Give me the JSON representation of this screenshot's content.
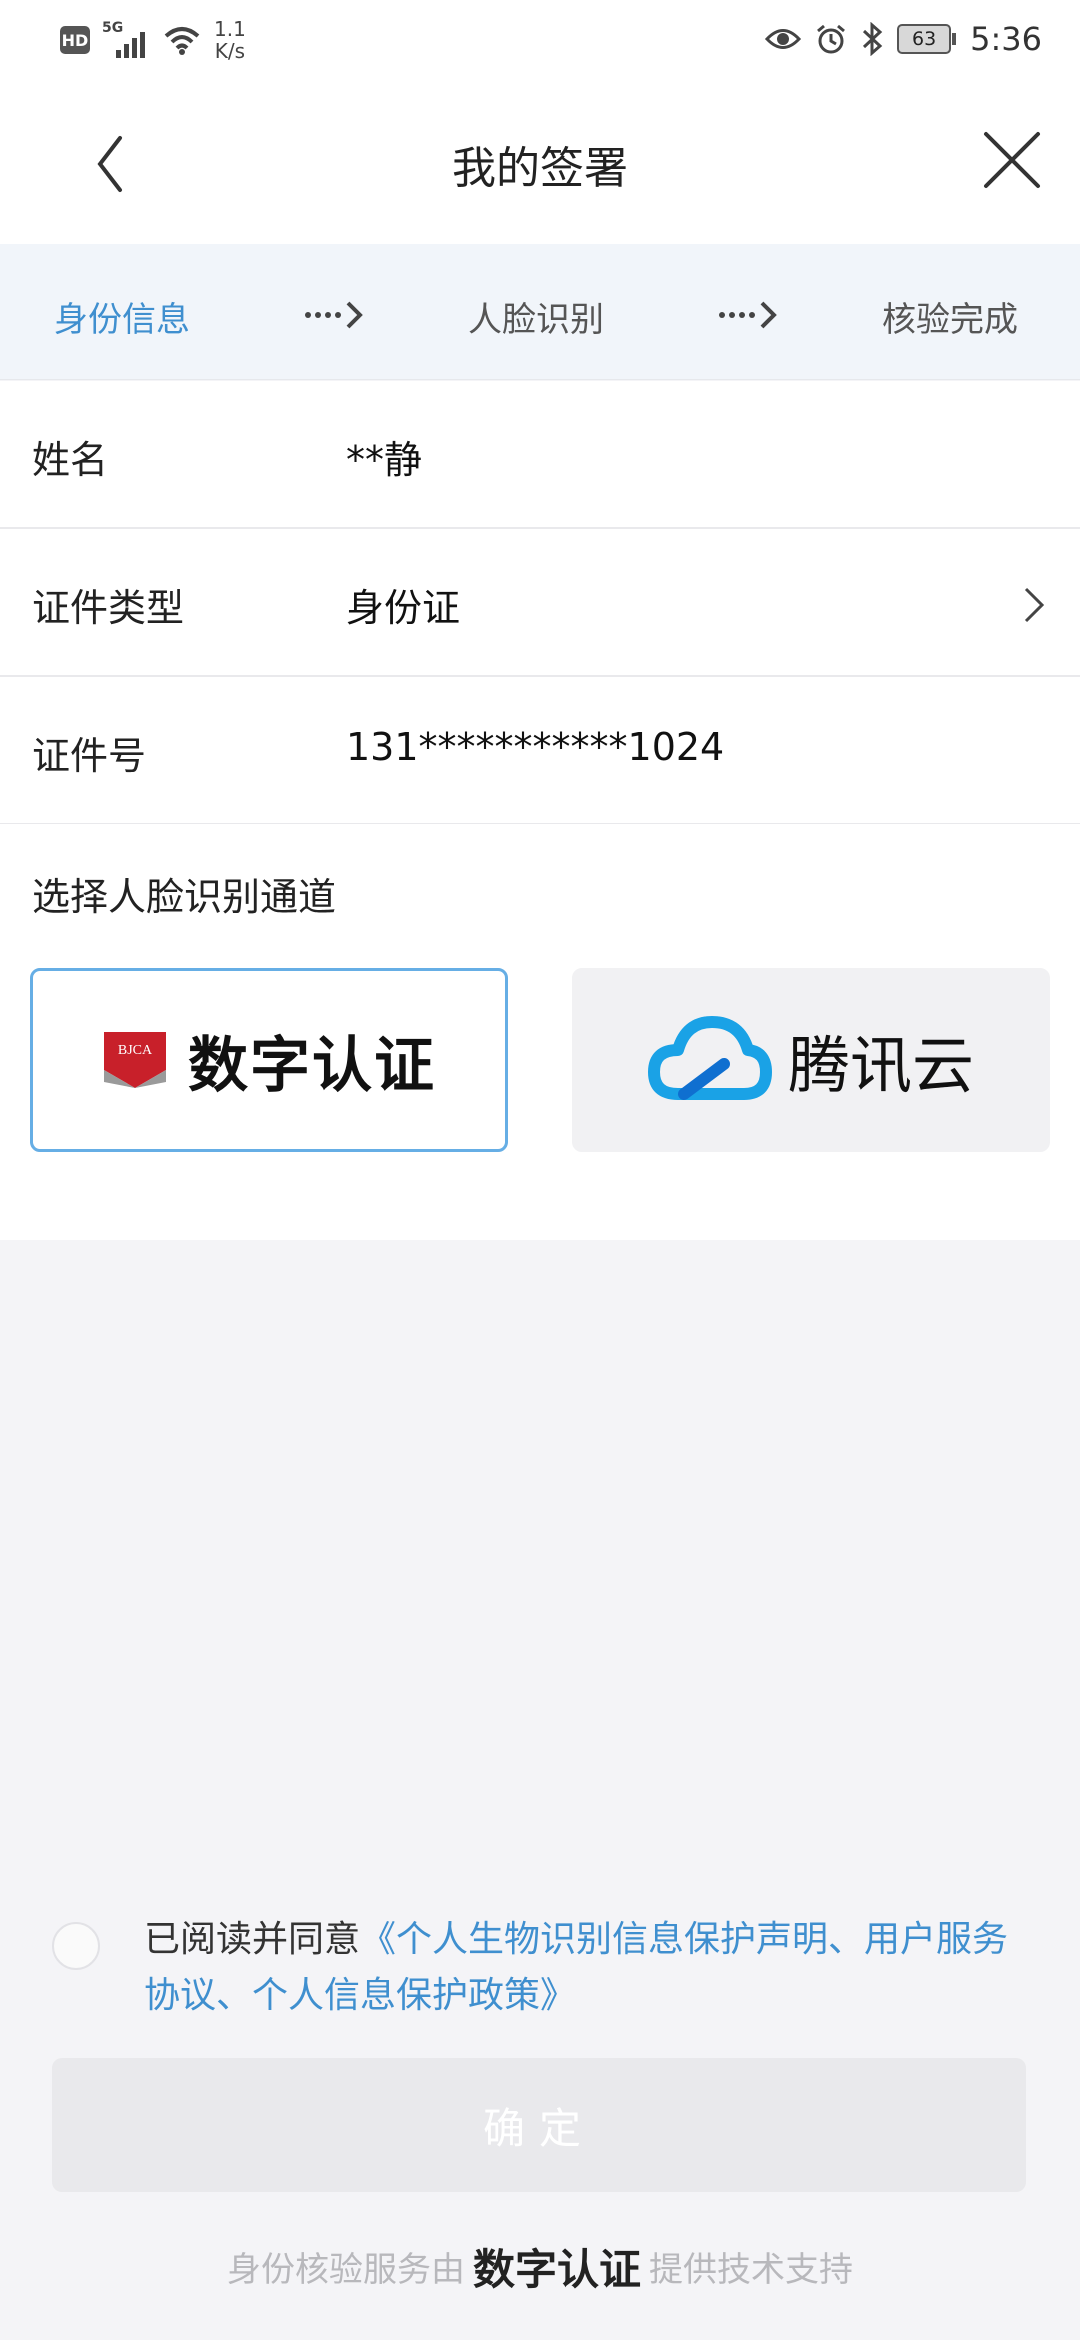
{
  "status_bar": {
    "hd": "HD",
    "network": "5G",
    "speed_value": "1.1",
    "speed_unit": "K/s",
    "battery": "63",
    "time": "5:36",
    "icons": [
      "eye-icon",
      "alarm-icon",
      "bluetooth-icon"
    ]
  },
  "nav": {
    "title": "我的签署",
    "back_icon": "chevron-left-icon",
    "close_icon": "close-icon"
  },
  "steps": {
    "items": [
      {
        "label": "身份信息",
        "active": true
      },
      {
        "label": "人脸识别",
        "active": false
      },
      {
        "label": "核验完成",
        "active": false
      }
    ],
    "arrow_icon": "dotted-arrow-icon"
  },
  "form": {
    "rows": [
      {
        "label": "姓名",
        "value": "**静"
      },
      {
        "label": "证件类型",
        "value": "身份证"
      },
      {
        "label": "证件号",
        "value": "131***********1024"
      }
    ]
  },
  "channel": {
    "title": "选择人脸识别通道",
    "options": [
      {
        "logo_text": "BJCA",
        "name": "数字认证",
        "selected": true
      },
      {
        "name": "腾讯云",
        "selected": false
      }
    ]
  },
  "agreement": {
    "prefix": "已阅读并同意",
    "link": "《个人生物识别信息保护声明、用户服务协议、个人信息保护政策》",
    "checked": false
  },
  "confirm": {
    "label": "确定"
  },
  "footer": {
    "prefix": "身份核验服务由",
    "brand": "数字认证",
    "suffix": "提供技术支持"
  },
  "colors": {
    "accent": "#3f8fcf",
    "selected_border": "#66aee5",
    "bjca_red": "#c8202a",
    "tencent_blue": "#1aa2e6",
    "disabled_button": "#e9e9ec"
  }
}
